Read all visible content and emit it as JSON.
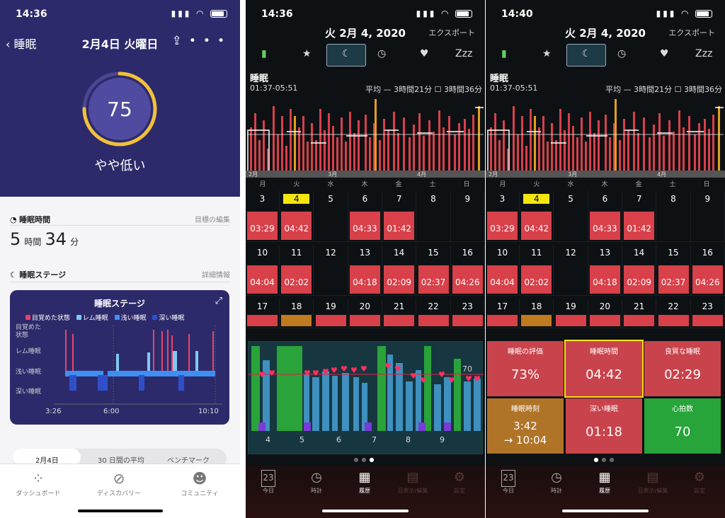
{
  "fitbit": {
    "status_time": "14:36",
    "back_label": "睡眠",
    "title": "2月4日 火曜日",
    "score": "75",
    "score_label": "やや低い",
    "sleep_time_title": "睡眠時間",
    "goal_edit": "目標の編集",
    "hours_num": "5",
    "hours_unit": "時間",
    "min_num": "34",
    "min_unit": "分",
    "stage_title": "睡眠ステージ",
    "details": "詳細情報",
    "card_title": "睡眠ステージ",
    "legend": [
      "目覚めた状態",
      "レム睡眠",
      "浅い睡眠",
      "深い睡眠"
    ],
    "ylabels": [
      "目覚めた\n状態",
      "レム睡眠",
      "浅い睡眠",
      "深い睡眠"
    ],
    "xlabels": [
      "3:26",
      "6:00",
      "10:10"
    ],
    "seg_tabs": [
      "2月4日",
      "30 日間の平均",
      "ベンチマーク"
    ],
    "tabbar": [
      "ダッシュボード",
      "ディスカバリー",
      "コミュニティ"
    ],
    "colors": {
      "awake": "#e8436a",
      "rem": "#7ec8f2",
      "light": "#3f8ff2",
      "deep": "#2f4fc8"
    }
  },
  "sleep_left": {
    "status_time": "14:36",
    "title": "火 2月 4, 2020",
    "export": "エクスポート",
    "label": "睡眠",
    "range": "01:37-05:51",
    "avg": "平均 — 3時間21分 ☐ 3時間36分",
    "axis": [
      "2月",
      "3月",
      "4月"
    ],
    "weekdays": [
      "月",
      "火",
      "水",
      "木",
      "金",
      "土",
      "日"
    ],
    "weeks": [
      [
        {
          "d": "3",
          "v": "03:29",
          "c": "red"
        },
        {
          "d": "4",
          "v": "04:42",
          "c": "red",
          "today": true
        },
        {
          "d": "5",
          "v": "",
          "c": ""
        },
        {
          "d": "6",
          "v": "04:33",
          "c": "red"
        },
        {
          "d": "7",
          "v": "01:42",
          "c": "red"
        },
        {
          "d": "8",
          "v": "",
          "c": ""
        },
        {
          "d": "9",
          "v": "",
          "c": ""
        }
      ],
      [
        {
          "d": "10",
          "v": "04:04",
          "c": "red"
        },
        {
          "d": "11",
          "v": "02:02",
          "c": "red"
        },
        {
          "d": "12",
          "v": "",
          "c": ""
        },
        {
          "d": "13",
          "v": "04:18",
          "c": "red"
        },
        {
          "d": "14",
          "v": "02:09",
          "c": "red"
        },
        {
          "d": "15",
          "v": "02:37",
          "c": "red"
        },
        {
          "d": "16",
          "v": "04:26",
          "c": "red"
        }
      ],
      [
        {
          "d": "17",
          "v": "",
          "c": "red"
        },
        {
          "d": "18",
          "v": "",
          "c": "orange"
        },
        {
          "d": "19",
          "v": "",
          "c": "red"
        },
        {
          "d": "20",
          "v": "",
          "c": "red"
        },
        {
          "d": "21",
          "v": "",
          "c": "red"
        },
        {
          "d": "22",
          "v": "",
          "c": "red"
        },
        {
          "d": "23",
          "v": "",
          "c": "red"
        }
      ]
    ],
    "hr_value": "70",
    "day_labels": [
      "4",
      "5",
      "6",
      "7",
      "8",
      "9"
    ],
    "tabbar": [
      "今日",
      "時計",
      "履歴",
      "日表示/編集",
      "設定"
    ],
    "cal_icon_num": "23"
  },
  "sleep_right": {
    "status_time": "14:40",
    "stats": [
      {
        "h": "睡眠の評価",
        "v": "73%",
        "c": "red"
      },
      {
        "h": "睡眠時間",
        "v": "04:42",
        "c": "red",
        "sel": true
      },
      {
        "h": "良質な睡眠",
        "v": "02:29",
        "c": "red"
      },
      {
        "h": "睡眠時刻",
        "v": "3:42",
        "v2": "→ 10:04",
        "c": "orange"
      },
      {
        "h": "深い睡眠",
        "v": "01:18",
        "c": "red"
      },
      {
        "h": "心拍数",
        "v": "70",
        "c": "green"
      }
    ]
  }
}
